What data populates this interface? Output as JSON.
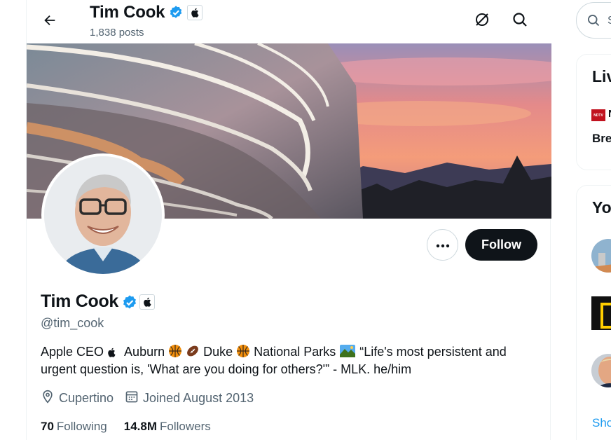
{
  "header": {
    "name": "Tim Cook",
    "posts": "1,838 posts",
    "back_icon": "arrow-left-icon",
    "grok_icon": "grok-slash-circle-icon",
    "search_icon": "search-icon"
  },
  "profile": {
    "name": "Tim Cook",
    "handle": "@tim_cook",
    "more_icon": "ellipsis-icon",
    "follow_label": "Follow",
    "bio": {
      "part1": "Apple CEO ",
      "part2": " Auburn ",
      "part3": " ",
      "part4": " Duke ",
      "part5": " National Parks ",
      "part6": " “Life's most persistent and urgent question is, 'What are you doing for others?'” - MLK. he/him"
    },
    "location": "Cupertino",
    "joined": "Joined August 2013",
    "following_count": "70",
    "following_label": "Following",
    "followers_count": "14.8M",
    "followers_label": "Followers"
  },
  "sidebar": {
    "search_placeholder": "S",
    "live_heading": "Liv",
    "live_source": "N",
    "live_headline": "Bre",
    "you_heading": "Yo",
    "show_more": "Sho"
  },
  "colors": {
    "accent": "#1d9bf0",
    "text_primary": "#0f1419",
    "text_secondary": "#536471",
    "follow_bg": "#0f1419"
  }
}
